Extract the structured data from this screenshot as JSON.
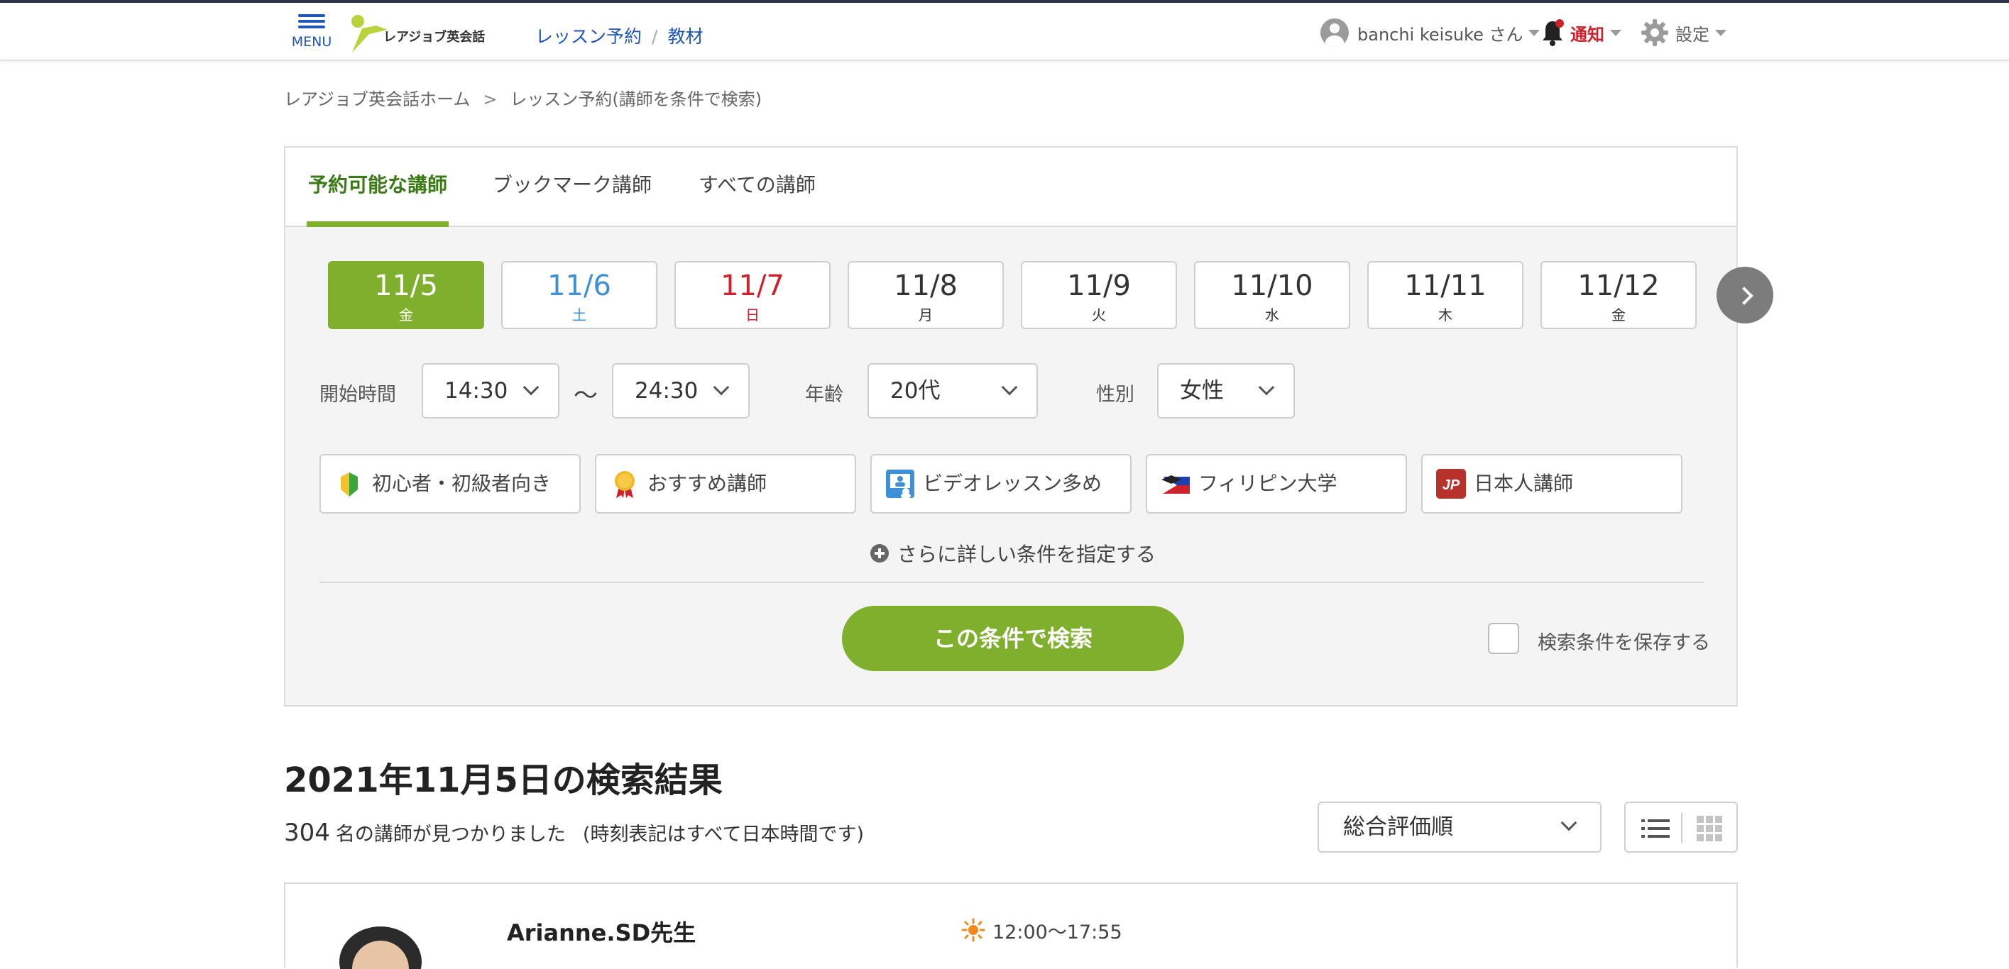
{
  "header": {
    "menu_label": "MENU",
    "logo_text": "レアジョブ英会話",
    "nav": {
      "lesson_reservation": "レッスン予約",
      "separator": "/",
      "materials": "教材"
    },
    "user_name": "banchi keisuke さん",
    "notification_label": "通知",
    "settings_label": "設定"
  },
  "breadcrumb": {
    "home": "レアジョブ英会話ホーム",
    "chevron": ">",
    "current": "レッスン予約(講師を条件で検索)"
  },
  "tabs": [
    {
      "label": "予約可能な講師",
      "active": true
    },
    {
      "label": "ブックマーク講師",
      "active": false
    },
    {
      "label": "すべての講師",
      "active": false
    }
  ],
  "dates": [
    {
      "date": "11/5",
      "weekday": "金",
      "state": "selected"
    },
    {
      "date": "11/6",
      "weekday": "土",
      "state": "saturday"
    },
    {
      "date": "11/7",
      "weekday": "日",
      "state": "sunday"
    },
    {
      "date": "11/8",
      "weekday": "月",
      "state": "normal"
    },
    {
      "date": "11/9",
      "weekday": "火",
      "state": "normal"
    },
    {
      "date": "11/10",
      "weekday": "水",
      "state": "normal"
    },
    {
      "date": "11/11",
      "weekday": "木",
      "state": "normal"
    },
    {
      "date": "11/12",
      "weekday": "金",
      "state": "normal"
    }
  ],
  "filters": {
    "start_time_label": "開始時間",
    "start_time_from": "14:30",
    "range_separator": "〜",
    "start_time_to": "24:30",
    "age_label": "年齢",
    "age_value": "20代",
    "gender_label": "性別",
    "gender_value": "女性"
  },
  "chips": [
    {
      "label": "初心者・初級者向き",
      "icon": "beginner-leaf-icon"
    },
    {
      "label": "おすすめ講師",
      "icon": "medal-icon"
    },
    {
      "label": "ビデオレッスン多め",
      "icon": "video-lesson-icon"
    },
    {
      "label": "フィリピン大学",
      "icon": "philippines-university-icon"
    },
    {
      "label": "日本人講師",
      "icon": "jp-badge-icon",
      "icon_text": "JP"
    }
  ],
  "more_conditions": "さらに詳しい条件を指定する",
  "search_button": "この条件で検索",
  "save_conditions_label": "検索条件を保存する",
  "results": {
    "title": "2021年11月5日の検索結果",
    "count": "304",
    "count_suffix": "名の講師が見つかりました",
    "note": "(時刻表記はすべて日本時間です)",
    "sort_value": "総合評価順"
  },
  "teachers": [
    {
      "name": "Arianne.SD先生",
      "available_time": "12:00〜17:55"
    }
  ],
  "colors": {
    "accent_green": "#7fb02d",
    "tab_active_text": "#3a7a17",
    "link_blue": "#1f56b8",
    "saturday_blue": "#3d8fd6",
    "sunday_red": "#d0202a",
    "notification_red": "#d0202a"
  }
}
